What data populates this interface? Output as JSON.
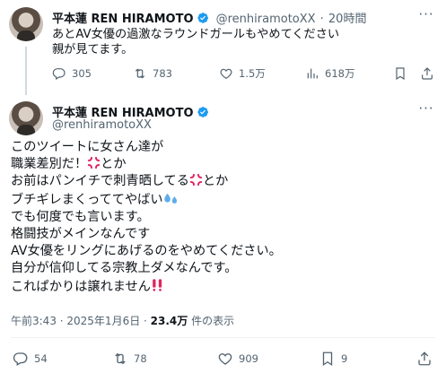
{
  "reply_tweet": {
    "display_name": "平本蓮 REN HIRAMOTO",
    "handle": "@renhiramotoXX",
    "separator": "·",
    "time": "20時間",
    "text_line1": "あとAV女優の過激なラウンドガールもやめてください",
    "text_line2": "親が見てます。",
    "replies": "305",
    "retweets": "783",
    "likes": "1.5万",
    "views": "618万"
  },
  "main_tweet": {
    "display_name": "平本蓮 REN HIRAMOTO",
    "handle": "@renhiramotoXX",
    "lines": [
      "このツイートに女さん達が",
      "職業差別だ！",
      "とか",
      "お前はパンイチで刺青晒してる",
      "とか",
      "ブチギレまくっててやばい",
      "でも何度でも言います。",
      "格闘技がメインなんです",
      "AV女優をリングにあげるのをやめてください。",
      "自分が信仰してる宗教上ダメなんです。",
      "これぱかりは譲れません"
    ],
    "timestamp": "午前3:43 · 2025年1月6日 · ",
    "view_count": "23.4万",
    "view_suffix": " 件の表示",
    "replies": "54",
    "retweets": "78",
    "likes": "909",
    "bookmarks": "9"
  },
  "colors": {
    "text": "#0f1419",
    "secondary": "#536471",
    "verified": "#1d9bf0",
    "divider": "#eff3f4",
    "anger_mark": "#e0245e",
    "double_exclamation": "#e0245e"
  },
  "icons": [
    "reply-icon",
    "retweet-icon",
    "like-icon",
    "views-icon",
    "bookmark-icon",
    "share-icon",
    "more-icon",
    "verified-icon",
    "anger-mark-emoji",
    "sweat-droplets-emoji",
    "double-exclamation-emoji"
  ]
}
